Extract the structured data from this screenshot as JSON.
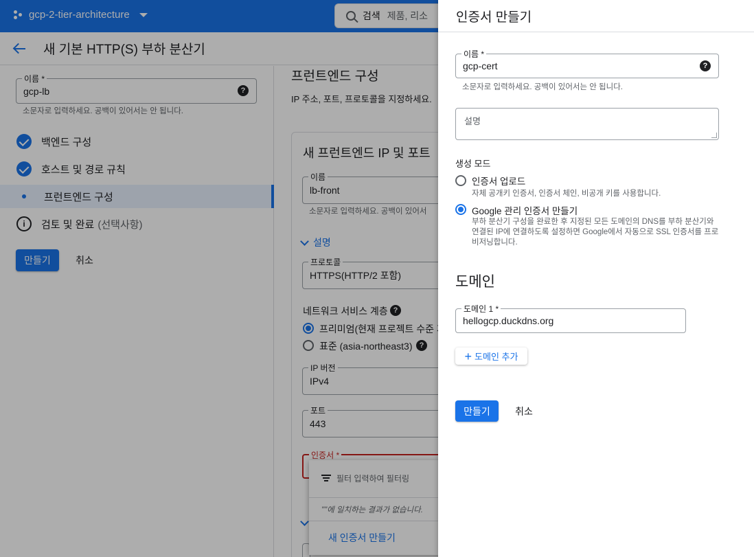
{
  "topbar": {
    "project": "gcp-2-tier-architecture",
    "search_label": "검색",
    "search_placeholder": "제품, 리소"
  },
  "page": {
    "title": "새 기본 HTTP(S) 부하 분산기"
  },
  "left": {
    "name_field": {
      "label": "이름 *",
      "value": "gcp-lb",
      "hint": "소문자로 입력하세요. 공백이 있어서는 안 됩니다."
    },
    "steps": [
      {
        "label": "백엔드 구성"
      },
      {
        "label": "호스트 및 경로 규칙"
      },
      {
        "label": "프런트엔드 구성"
      },
      {
        "label": "검토 및 완료",
        "suffix": "(선택사항)"
      }
    ],
    "create_button": "만들기",
    "cancel_button": "취소"
  },
  "frontend": {
    "title": "프런트엔드 구성",
    "subtitle": "IP 주소, 포트, 프로토콜을 지정하세요.",
    "card_title": "새 프런트엔드 IP 및 포트",
    "name_field": {
      "label": "이름",
      "value": "lb-front",
      "hint": "소문자로 입력하세요. 공백이 있어서"
    },
    "description_toggle": "설명",
    "protocol": {
      "label": "프로토콜",
      "value": "HTTPS(HTTP/2 포함)"
    },
    "network_tier": {
      "label": "네트워크 서비스 계층",
      "options": [
        {
          "label": "프리미엄(현재 프로젝트 수준 계",
          "selected": true
        },
        {
          "label": "표준 (asia-northeast3)",
          "selected": false
        }
      ]
    },
    "ip_version": {
      "label": "IP 버전",
      "value": "IPv4"
    },
    "port": {
      "label": "포트",
      "value": "443"
    },
    "certificate": {
      "label": "인증서 *"
    },
    "dropdown": {
      "filter_placeholder": "필터 입력하여 필터링",
      "no_results": "\"\"에 일치하는 결과가 없습니다.",
      "create_cert": "새 인증서 만들기"
    }
  },
  "panel": {
    "title": "인증서 만들기",
    "name_field": {
      "label": "이름 *",
      "value": "gcp-cert",
      "hint": "소문자로 입력하세요. 공백이 있어서는 안 됩니다."
    },
    "description_field": {
      "placeholder": "설명"
    },
    "mode": {
      "label": "생성 모드",
      "options": [
        {
          "title": "인증서 업로드",
          "desc": "자체 공개키 인증서, 인증서 체인, 비공개 키를 사용합니다.",
          "selected": false
        },
        {
          "title": "Google 관리 인증서 만들기",
          "desc": "부하 분산기 구성을 완료한 후 지정된 모든 도메인의 DNS를 부하 분산기와 연결된 IP에 연결하도록 설정하면 Google에서 자동으로 SSL 인증서를 프로비저닝합니다.",
          "selected": true
        }
      ]
    },
    "domain": {
      "heading": "도메인",
      "field": {
        "label": "도메인 1 *",
        "value": "hellogcp.duckdns.org"
      },
      "add_button": "도메인 추가"
    },
    "create_button": "만들기",
    "cancel_button": "취소"
  },
  "colors": {
    "primary": "#1a73e8",
    "error": "#c5221f"
  }
}
